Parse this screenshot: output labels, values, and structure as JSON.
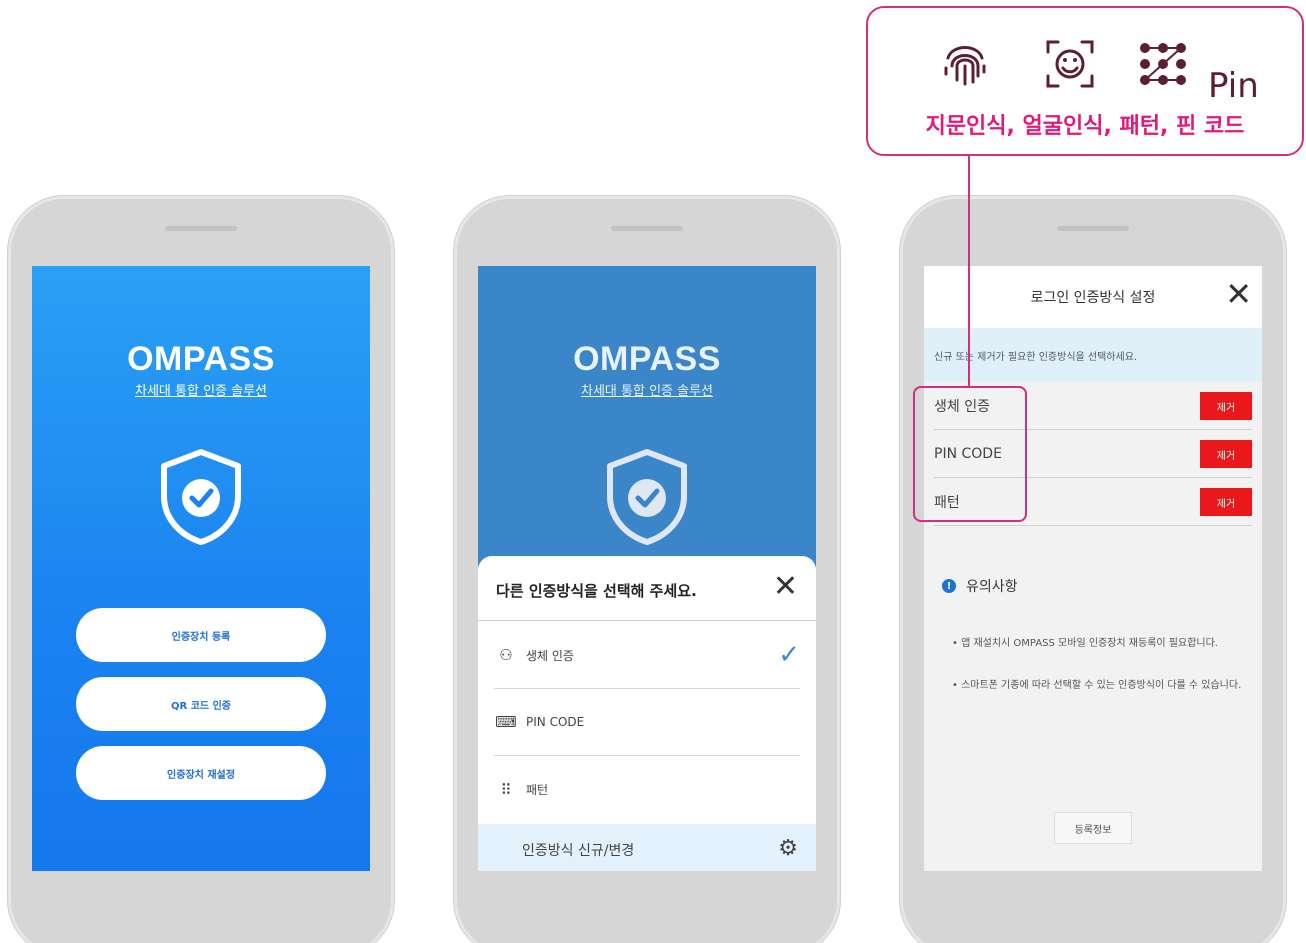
{
  "phone1": {
    "brand_title": "OMPASS",
    "brand_subtitle": "차세대 통합 인증 솔루션",
    "buttons": [
      "인증장치 등록",
      "QR 코드 인증",
      "인증장치 재설정"
    ]
  },
  "phone2": {
    "brand_title": "OMPASS",
    "brand_subtitle": "차세대 통합 인증 솔루션",
    "sheet_title": "다른 인증방식을 선택해 주세요.",
    "options": [
      "생체 인증",
      "PIN CODE",
      "패턴"
    ],
    "footer_label": "인증방식 신규/변경"
  },
  "phone3": {
    "header_title": "로그인 인증방식 설정",
    "info_text": "신규 또는 제거가 필요한 인증방식을 선택하세요.",
    "methods": [
      "생체 인증",
      "PIN CODE",
      "패턴"
    ],
    "remove_label": "제거",
    "notice_title": "유의사항",
    "notices": [
      "• 앱 재설치시 OMPASS 모바일 인증장치 재등록이 필요합니다.",
      "• 스마트폰 기종에 따라 선택할 수 있는 인증방식이 다를 수 있습니다."
    ],
    "register_info_button": "등록정보"
  },
  "callout": {
    "pin_text": "Pin",
    "label": "지문인식, 얼굴인식, 패턴, 핀 코드"
  },
  "colors": {
    "accent_blue": "#1a82f0",
    "remove_red": "#e8181b",
    "callout_pink": "#d0307f"
  },
  "icons": [
    "shield-check-icon",
    "close-icon",
    "person-icon",
    "checkmark-icon",
    "keyboard-icon",
    "pattern-grid-icon",
    "gear-icon",
    "info-icon",
    "fingerprint-icon",
    "face-scan-icon",
    "pattern-dots-icon"
  ]
}
